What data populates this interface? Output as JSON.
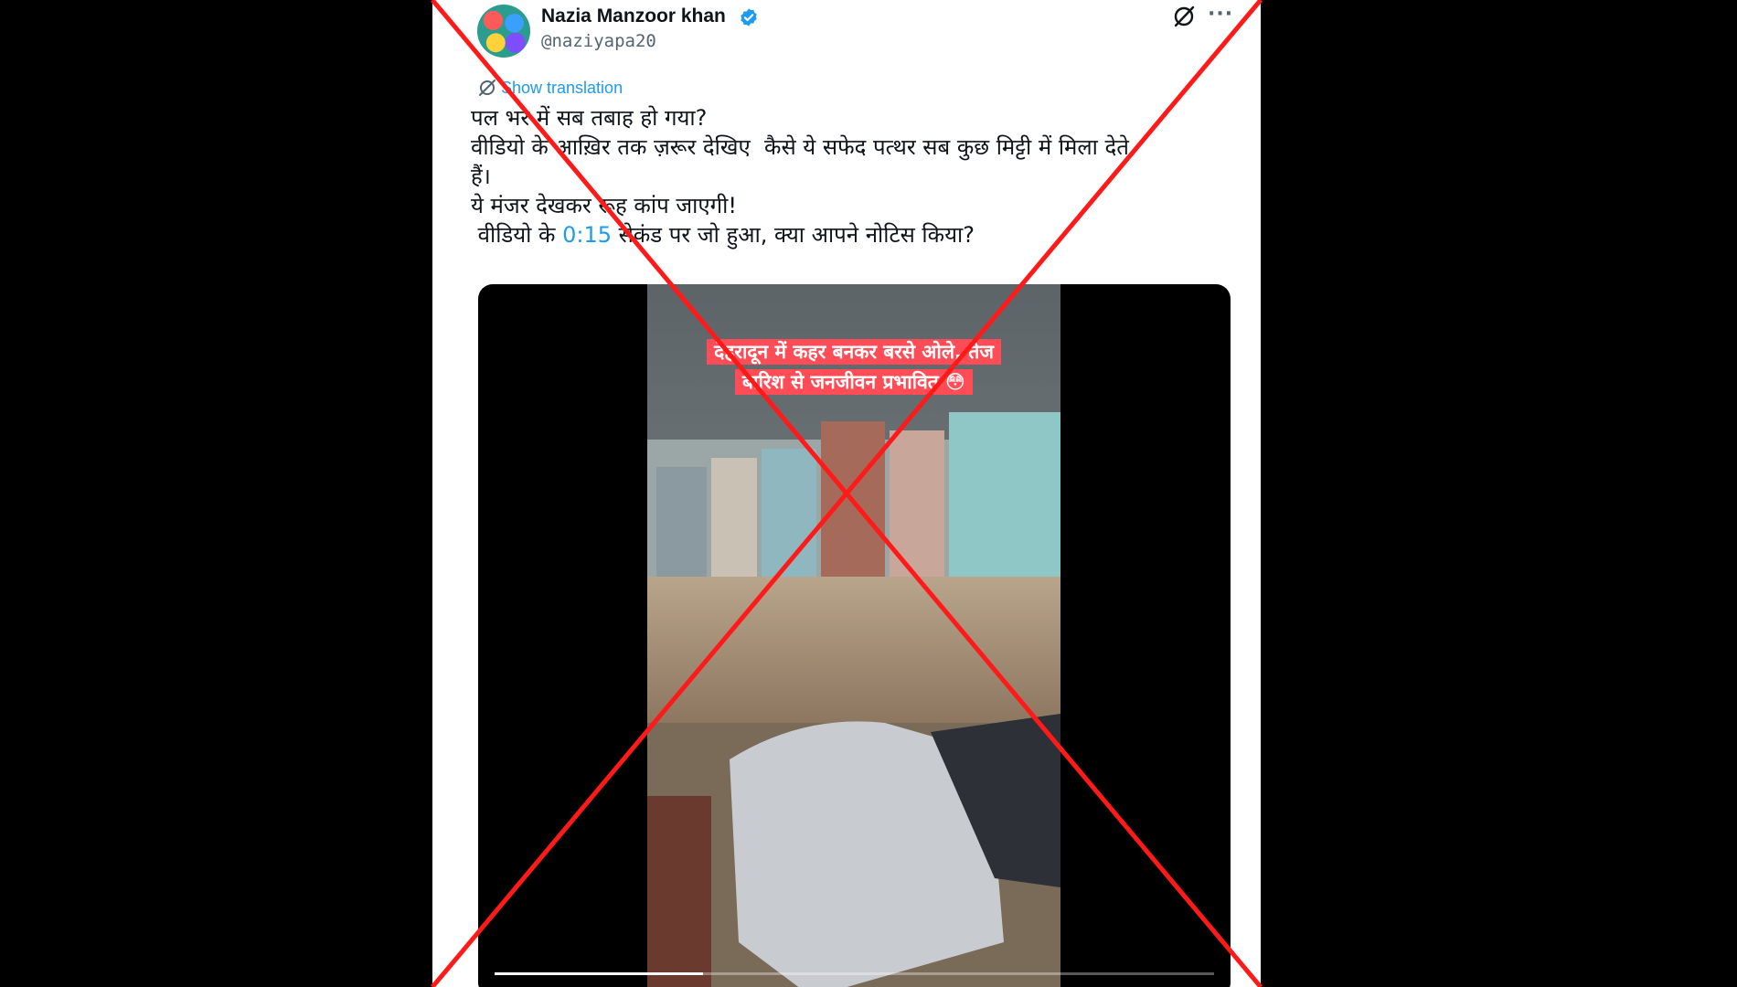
{
  "tweet": {
    "author_name": "Nazia Manzoor khan",
    "author_handle": "@naziyapa20",
    "translate_label": "Show translation",
    "text_lines": [
      "पल भर में सब तबाह हो गया?",
      "वीडियो के आख़िर तक ज़रूर देखिए  कैसे ये सफेद पत्थर सब कुछ मिट्टी में मिला देते",
      "हैं।",
      "ये मंजर देखकर रूह कांप जाएगी!"
    ],
    "last_line_before": " वीडियो के ",
    "timestamp_link": "0:15",
    "last_line_after": " सेकंड पर जो हुआ, क्या आपने नोटिस किया?"
  },
  "video": {
    "caption_line1": "देहरादून में कहर बनकर बरसे ओले, तेज",
    "caption_line2": "बारिश से जनजीवन प्रभावित 😳",
    "progress_fraction": 0.29
  },
  "colors": {
    "accent": "#1d9bf0",
    "overlay_cross": "#ff1a1a",
    "caption_bg": "#ff4d57"
  },
  "icons": {
    "verified": "verified-badge-icon",
    "grok": "grok-icon",
    "more": "more-options-icon",
    "translate": "translate-icon"
  }
}
